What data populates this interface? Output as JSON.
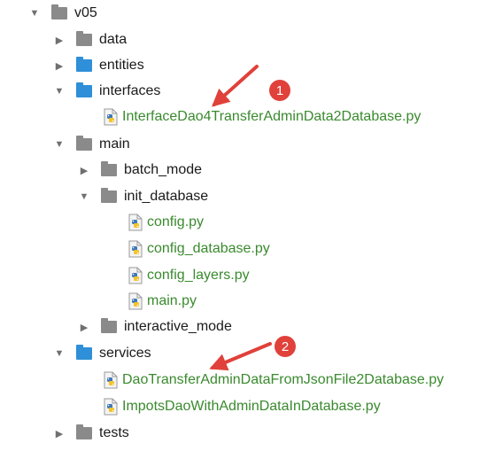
{
  "tree": {
    "root": "v05",
    "data": "data",
    "entities": "entities",
    "interfaces": "interfaces",
    "interface_file": "InterfaceDao4TransferAdminData2Database.py",
    "main": "main",
    "batch_mode": "batch_mode",
    "init_database": "init_database",
    "config": "config.py",
    "config_database": "config_database.py",
    "config_layers": "config_layers.py",
    "main_py": "main.py",
    "interactive_mode": "interactive_mode",
    "services": "services",
    "dao_transfer": "DaoTransferAdminDataFromJsonFile2Database.py",
    "impots_dao": "ImpotsDaoWithAdminDataInDatabase.py",
    "tests": "tests"
  },
  "annotations": {
    "badge1": "1",
    "badge2": "2"
  },
  "colors": {
    "folder_blue": "#2f8fd8",
    "folder_grey": "#8a8a8a",
    "file_green": "#3a8a2e",
    "annotation_red": "#e0413a"
  }
}
